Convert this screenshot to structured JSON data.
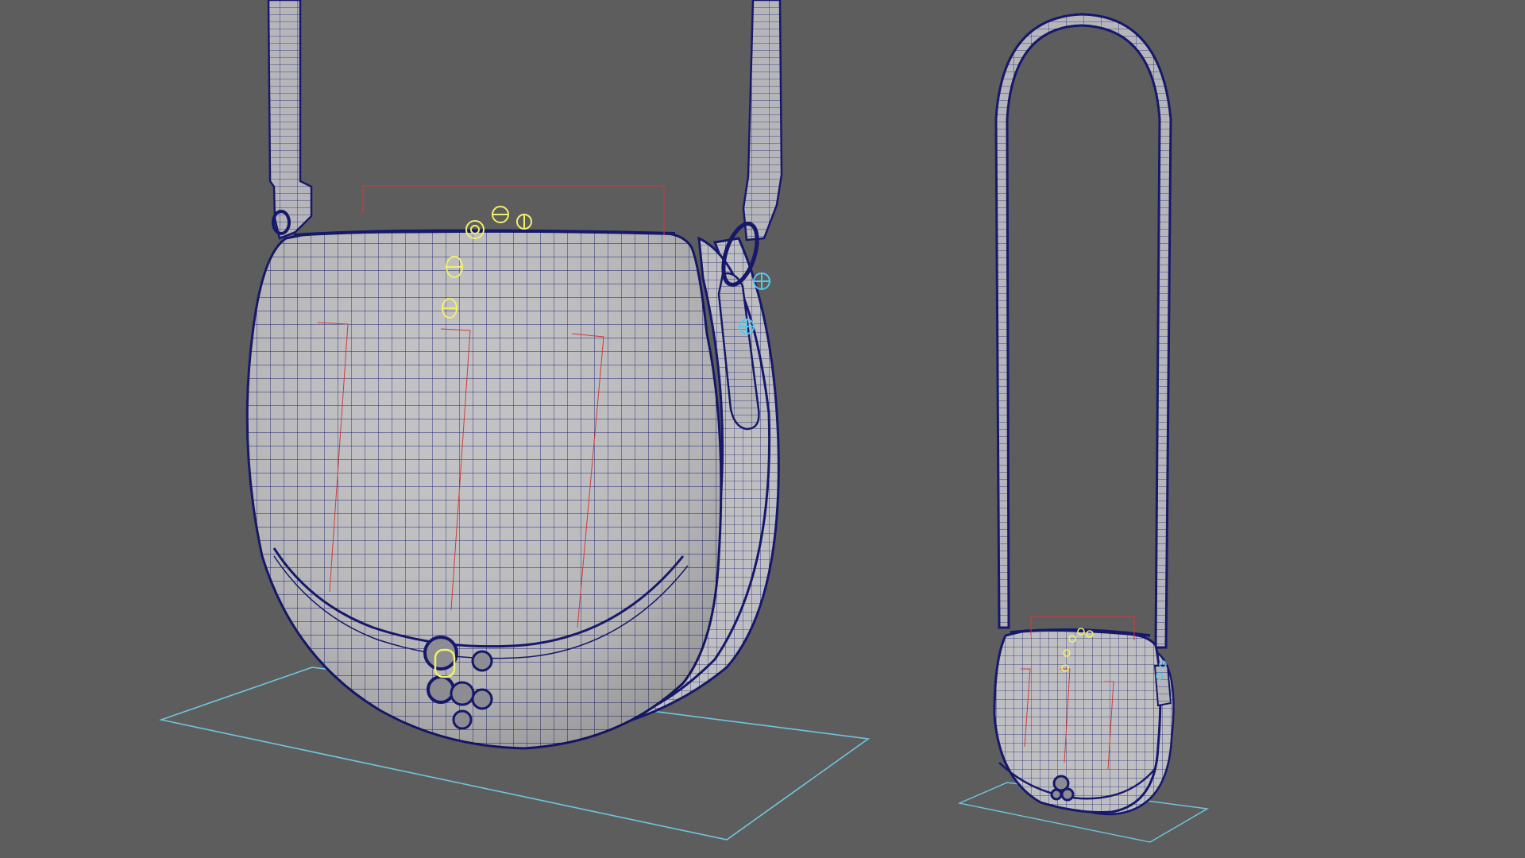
{
  "viewport": {
    "background": "#5d5d5d",
    "wireframe_color": "#16186b",
    "surface_color": "#bdbdbf",
    "ground_plane_color": "#6fc6e0",
    "rig_control_color": "#f2f06a",
    "side_control_color": "#58c8ea",
    "guide_color": "#d03a3a"
  },
  "objects": [
    {
      "name": "saddle-bag",
      "view": "close-up",
      "strap": "crossbody",
      "clasp": "turn-lock"
    },
    {
      "name": "saddle-bag",
      "view": "full-length",
      "strap": "crossbody",
      "clasp": "turn-lock"
    }
  ]
}
